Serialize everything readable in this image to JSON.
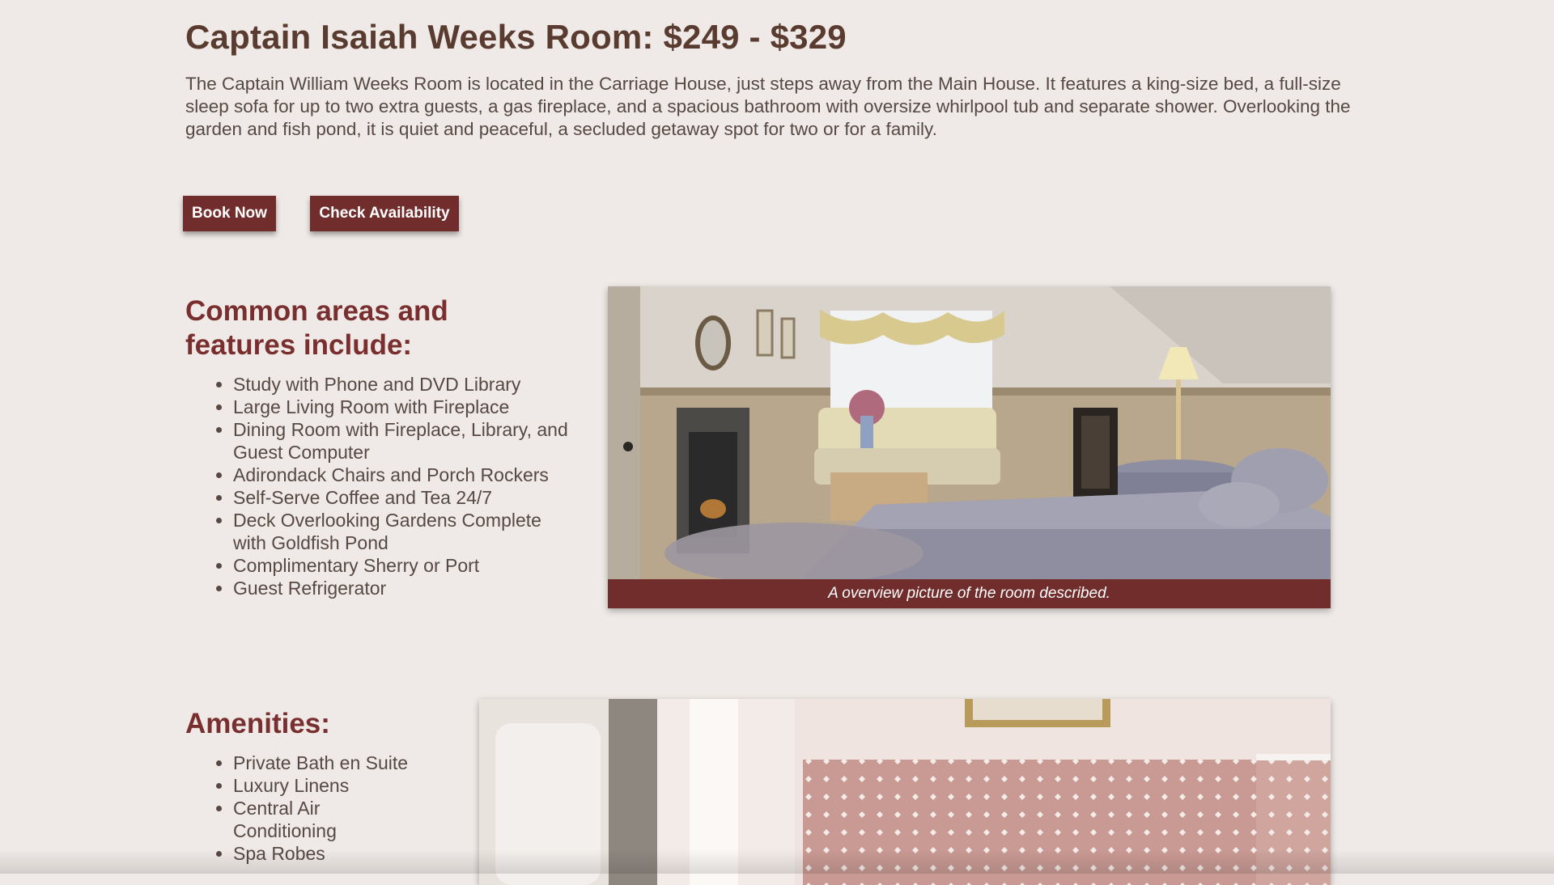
{
  "room": {
    "title": "Captain Isaiah Weeks Room: $249 - $329",
    "description": "The Captain William Weeks Room is located in the Carriage House, just steps away from the Main House. It features a king-size bed, a full-size sleep sofa for up to two extra guests, a gas fireplace, and a spacious bathroom with oversize whirlpool tub and separate shower. Overlooking the garden and fish pond, it is quiet and peaceful, a secluded getaway spot for two or for a family."
  },
  "buttons": {
    "book_now": "Book Now",
    "check_availability": "Check Availability"
  },
  "common_areas": {
    "heading": "Common areas and features include:",
    "items": [
      "Study with Phone and DVD Library",
      "Large Living Room with Fireplace",
      "Dining Room with Fireplace, Library, and Guest Computer",
      "Adirondack Chairs and Porch Rockers",
      "Self-Serve Coffee and Tea 24/7",
      "Deck Overlooking Gardens Complete with Goldfish Pond",
      "Complimentary Sherry or Port",
      "Guest Refrigerator"
    ]
  },
  "room_image": {
    "caption": "A overview picture of the room described."
  },
  "amenities": {
    "heading": "Amenities:",
    "items": [
      "Private Bath en Suite",
      "Luxury Linens",
      "Central Air Conditioning",
      "Spa Robes"
    ]
  },
  "colors": {
    "accent": "#712c2c",
    "heading": "#7a2f2f",
    "title": "#5a3b2f",
    "background": "#efeae7"
  }
}
